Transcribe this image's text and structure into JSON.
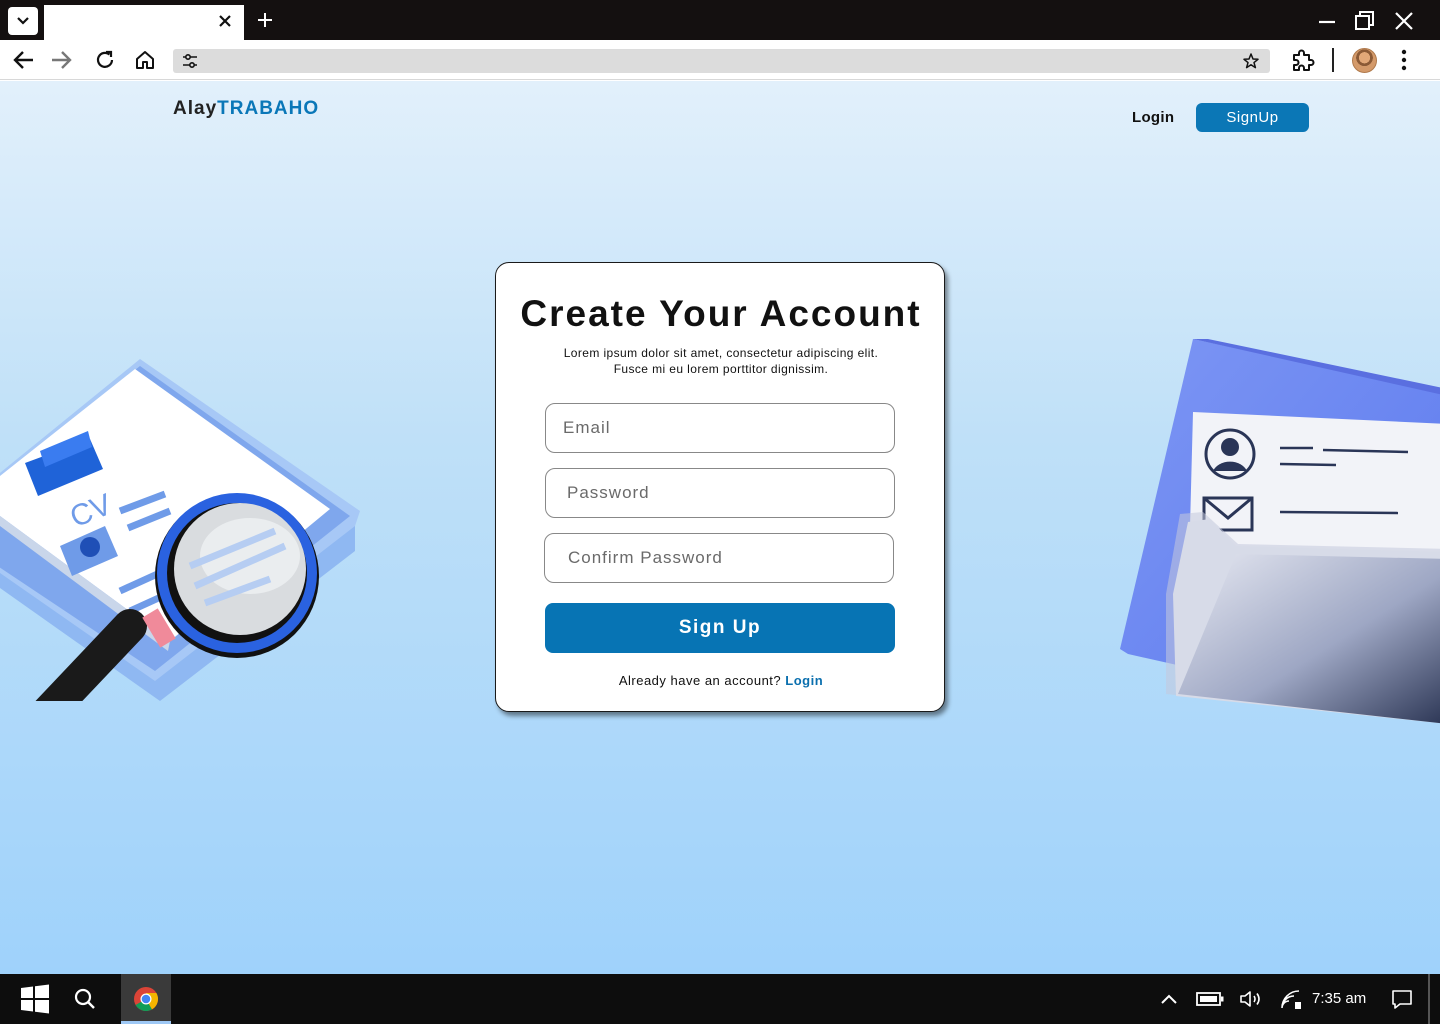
{
  "browser": {
    "tab_title": "",
    "address": ""
  },
  "site": {
    "logo_part1": "Alay",
    "logo_part2": "TRABAHO",
    "nav_login": "Login",
    "nav_signup": "SignUp"
  },
  "form": {
    "title": "Create Your Account",
    "subtitle_line1": "Lorem ipsum dolor sit amet, consectetur adipiscing elit.",
    "subtitle_line2": "Fusce mi eu lorem porttitor dignissim.",
    "email_placeholder": "Email",
    "password_placeholder": "Password",
    "confirm_placeholder": "Confirm Password",
    "submit_label": "Sign Up",
    "already_text": "Already have an account?",
    "login_link": "Login"
  },
  "illustration": {
    "clipboard_label": "CV"
  },
  "taskbar": {
    "time": "7:35 am"
  },
  "colors": {
    "brand": "#0a77b8",
    "button": "#0774b4"
  }
}
